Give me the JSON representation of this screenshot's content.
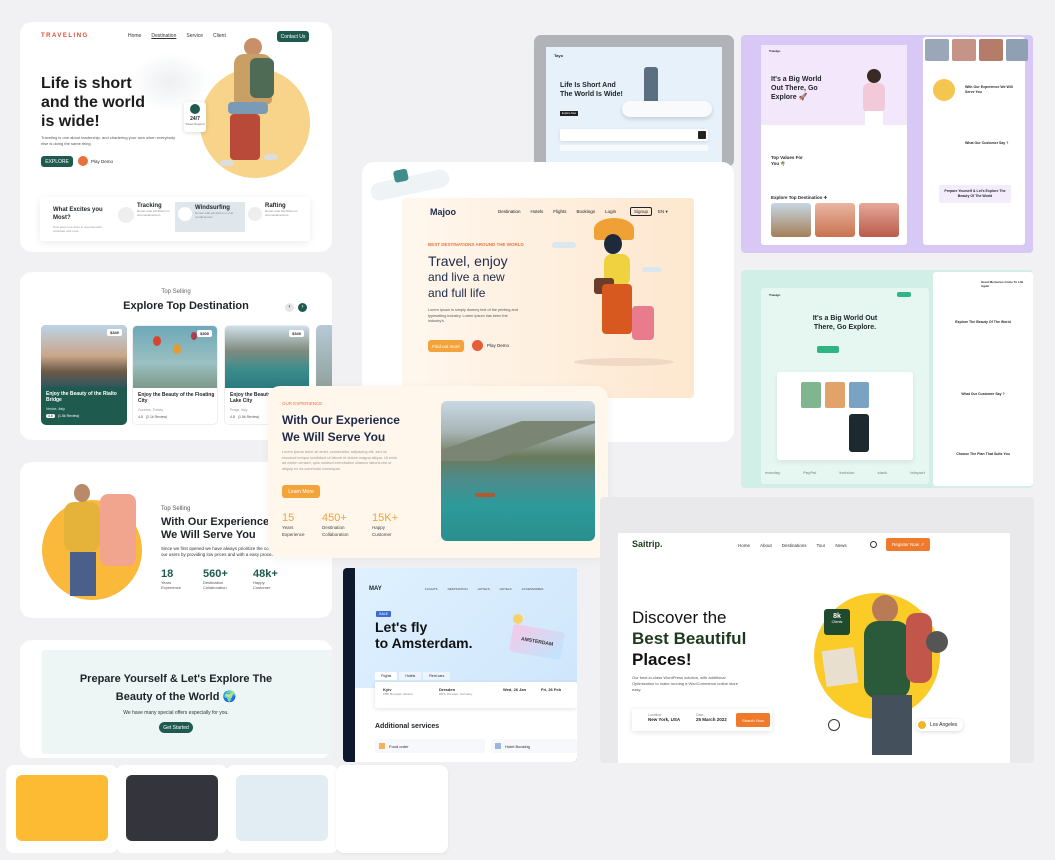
{
  "palette": {
    "colors": [
      "#fdbb33",
      "#34343c",
      "#e1ecf3",
      "#ffffff"
    ]
  },
  "traveling": {
    "brand": "TRAVELING",
    "nav": [
      "Home",
      "Destination",
      "Service",
      "Client"
    ],
    "contact": "Contact Us",
    "headline": [
      "Life is short",
      "and the world",
      "is wide!"
    ],
    "sub": "Traveling is one about leadership, and chartering your own when everybody else is doing the same thing",
    "explore": "EXPLORE",
    "demo": "Play Demo",
    "support": "24/7",
    "support_label": "Travel Support",
    "excites_title": "What Excites you Most?",
    "excites_sub": "Duis aute irure dolor in reprehenderit voluptate velit esse",
    "features": [
      {
        "title": "Tracking",
        "desc": "Donec odio elit dictum in nisl condimentum"
      },
      {
        "title": "Windsurfing",
        "desc": "Donec odio elit dictum in nisl condimentum"
      },
      {
        "title": "Rafting",
        "desc": "Donec odio elit dictum in nisl condimentum"
      }
    ]
  },
  "topdest": {
    "eyebrow": "Top Selling",
    "title": "Explore Top Destination",
    "cards": [
      {
        "price": "$340",
        "title": "Enjoy the Beauty of the Rialto Bridge",
        "loc": "Venice, Italy",
        "rating": "4.8",
        "reviews": "(1.5k Review)"
      },
      {
        "price": "$300",
        "title": "Enjoy the Beauty of the Floating City",
        "loc": "Goreme, Turkey",
        "rating": "4.8",
        "reviews": "(2.1k Review)"
      },
      {
        "price": "$340",
        "title": "Enjoy the Beauty of the Braies Lake City",
        "loc": "Prags, Italy",
        "rating": "4.8",
        "reviews": "(1.5k Review)"
      }
    ]
  },
  "serve": {
    "eyebrow": "Top Selling",
    "title": [
      "With Our Experience",
      "We Will Serve You"
    ],
    "text": "Since we first opened we have always prioritize the convenience of our users by providing low prices and with a easy process.",
    "stats": [
      {
        "value": "18",
        "label": "Years Experience"
      },
      {
        "value": "560+",
        "label": "Destination Collaboration"
      },
      {
        "value": "48k+",
        "label": "Happy Customer"
      }
    ]
  },
  "prepare": {
    "title": [
      "Prepare Yourself & Let's Explore The",
      "Beauty of the World 🌍"
    ],
    "sub": "We have many special offers especially for you.",
    "cta": "Get Started"
  },
  "tayo": {
    "brand": "Tayo",
    "headline": [
      "Life Is Short And",
      "The World Is Wide!"
    ],
    "cta": "Explore Now"
  },
  "trawlgo_pink": {
    "brand": "Trawlgo",
    "title": [
      "It's a Big World",
      "Out There, Go",
      "Explore 🚀"
    ],
    "values": "Top Values For You 🌴",
    "explore": "Explore Top Destination ✈",
    "serve": "With Our Experience We Will Serve You",
    "customer": "What Our Customer Say ?",
    "prepare": "Prepare Yourself & Let's Explore The Beauty Of The World"
  },
  "majoo": {
    "brand": "Majoo",
    "nav": [
      "Destination",
      "Hotels",
      "Flights",
      "Bookings",
      "Login"
    ],
    "signup": "Signup",
    "lang": "EN ▾",
    "eyebrow": "BEST DESTINATIONS AROUND THE WORLD",
    "headline": [
      "Travel, enjoy",
      "and live a new",
      "and full life"
    ],
    "sub": "Lorem Ipsum is simply dummy text of the printing and typesetting industry. Lorem Ipsum has been the industry's",
    "cta": "Find out more",
    "demo": "Play Demo"
  },
  "trawlgo_green": {
    "brand": "Trawlgo",
    "title": [
      "It's a Big World Out",
      "There, Go Explore."
    ],
    "beauty": "Explore The Beauty Of The World",
    "customer": "What Our Customer Say ?",
    "plan": "Choose The Plan That Suits You",
    "memories": "Great Memories Come To Life Again",
    "logos": [
      "monday",
      "PayPal",
      "Invision",
      "slack",
      "teleport"
    ]
  },
  "experience": {
    "eyebrow": "OUR EXPERIENCE",
    "title": [
      "With Our Experience",
      "We Will Serve You"
    ],
    "text": "Lorem ipsum dolor sit amet, consectetur adipiscing elit, sed do eiusmod tempor incididunt ut labore et dolore magna aliqua. Ut enim ad minim veniam, quis nostrud exercitation ullamco laboris nisi ut aliquip ex ea commodo consequat.",
    "cta": "Learn More",
    "stats": [
      {
        "value": "15",
        "label": "Years Experience"
      },
      {
        "value": "450+",
        "label": "Destination Collaboration"
      },
      {
        "value": "15K+",
        "label": "Happy Customer"
      }
    ]
  },
  "may": {
    "brand": "MAY",
    "nav": [
      "FLIGHTS",
      "DESTINATION",
      "HOTELS",
      "HOTELS",
      "ACCESSORIES"
    ],
    "sale": "SALE",
    "title": [
      "Let's fly",
      "to Amsterdam."
    ],
    "stamp": "AMSTERDAM",
    "tabs": [
      "Flights",
      "Hotels",
      "Rent cars"
    ],
    "from": "Kyiv",
    "from_sub": "KBP, Boryspil, Ukraine",
    "to": "Dresden",
    "to_sub": "DRS, Dresden, Germany",
    "date1": "Wed, 26 Jan",
    "date2": "Fri, 26 Feb",
    "additional": "Additional services",
    "food": "Food order",
    "hotel": "Hotel Booking"
  },
  "saitrip": {
    "brand": "Saitrip.",
    "nav": [
      "Home",
      "About",
      "Destinations",
      "Tour",
      "News"
    ],
    "register": "Register Now ↗",
    "headline": [
      "Discover the",
      "Best Beautiful",
      "Places!"
    ],
    "sub": "Our best-in-class WordPress solution, with additional Optimization to make running a WooCommerce online store easy.",
    "loc_label": "Location",
    "loc": "New York, USA",
    "date_label": "Date",
    "date": "25 March 2022",
    "search": "Search Now",
    "clients_num": "8k",
    "clients": "Clients",
    "la": "Los Angeles"
  }
}
